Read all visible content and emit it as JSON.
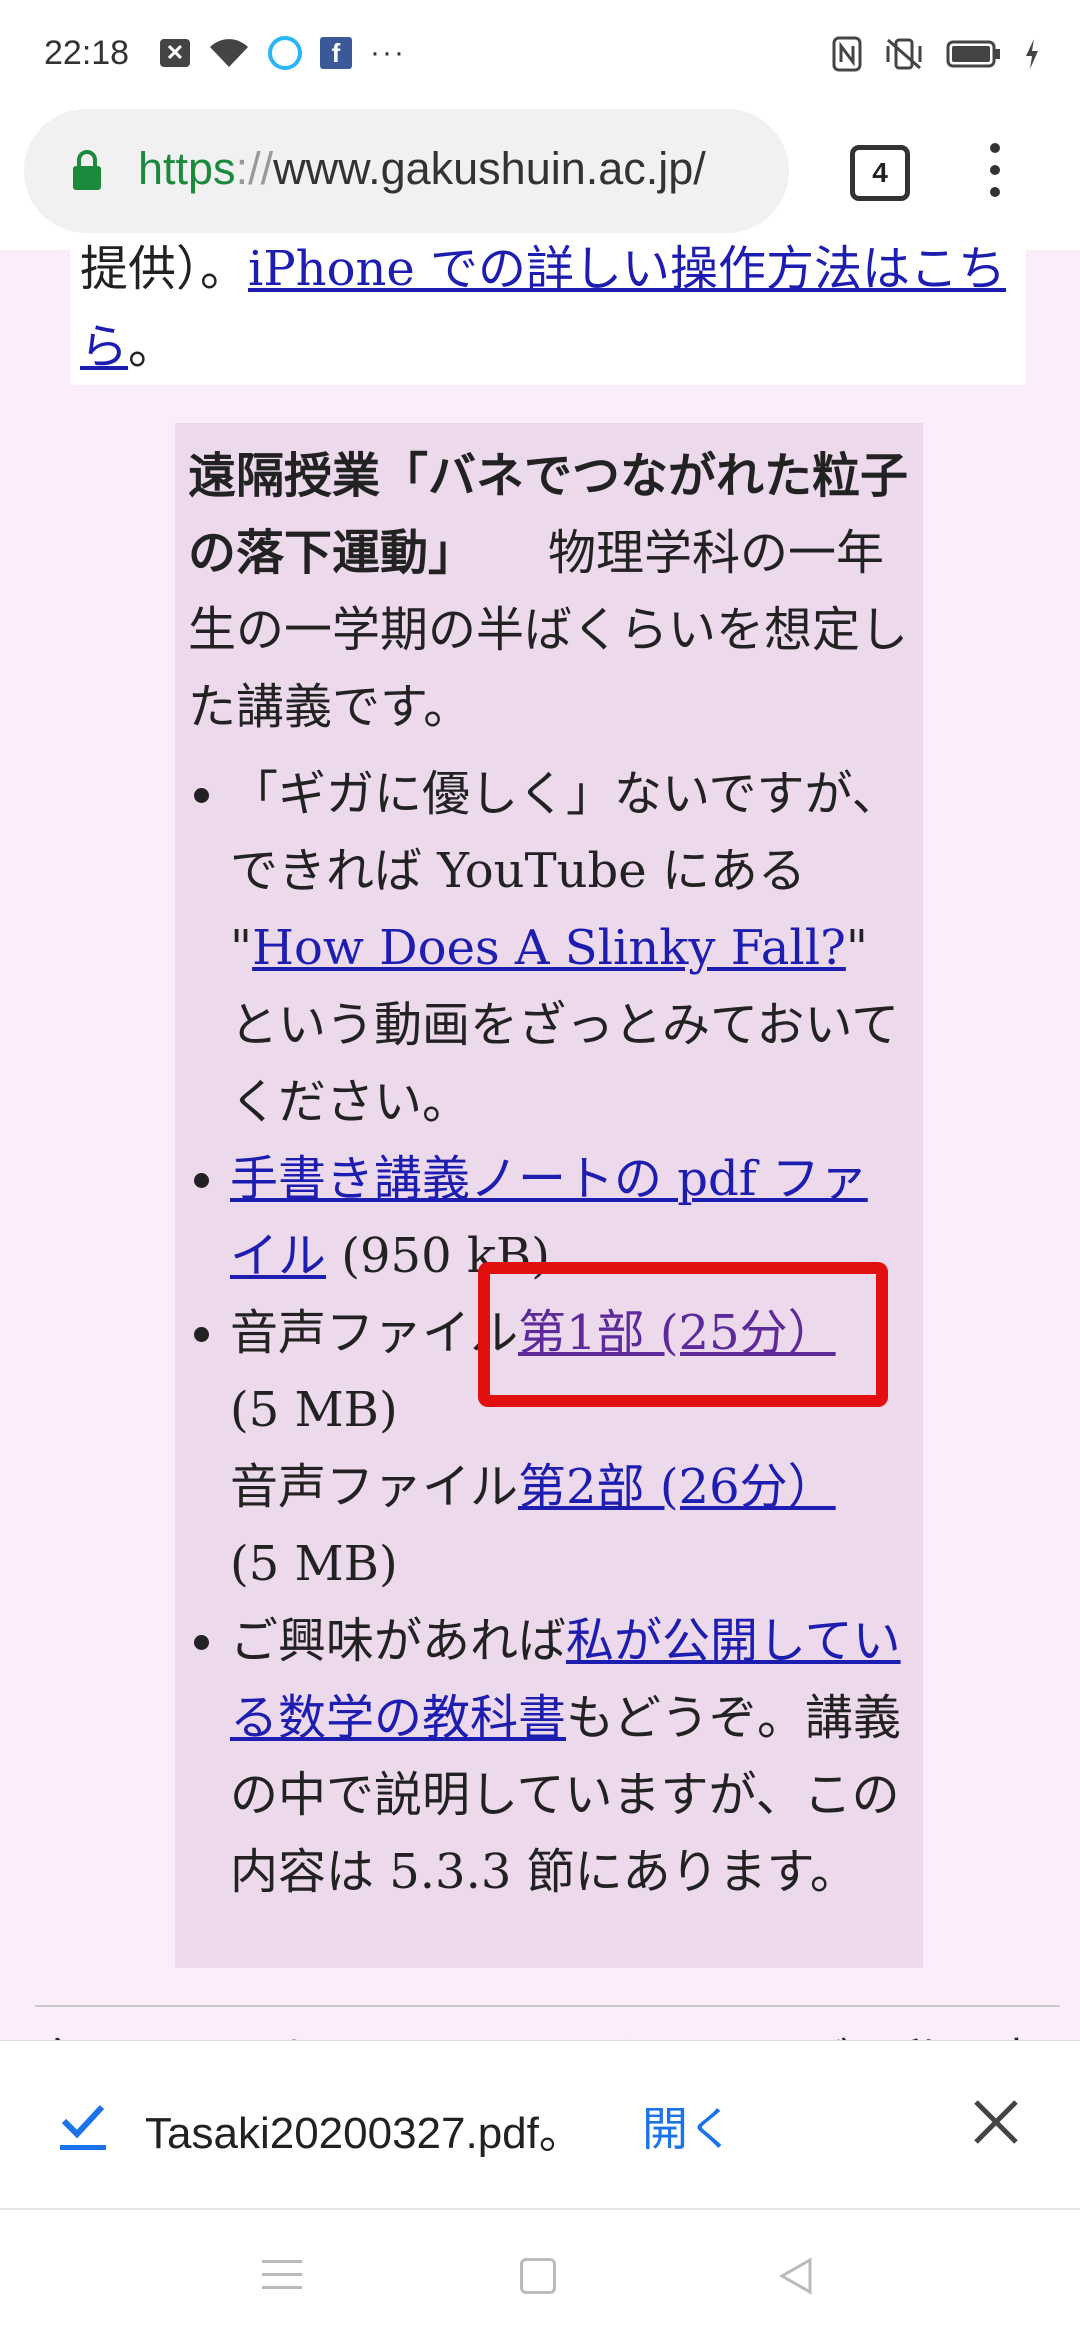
{
  "status": {
    "time": "22:18",
    "dots": "···"
  },
  "browser": {
    "url_scheme": "https",
    "url_sep": "://",
    "url_rest": "www.gakushuin.ac.jp/",
    "tab_count": "4"
  },
  "page": {
    "top_prefix": "提供）。",
    "top_link": "iPhone での詳しい操作方法はこちら",
    "top_suffix": "。",
    "heading": "遠隔授業「バネでつながれた粒子の落下運動」",
    "intro": "物理学科の一年生の一学期の半ばくらいを想定した講義です。",
    "bullet1_a": "「ギガに優しく」ないですが、できれば YouTube にある \"",
    "bullet1_link": "How Does A Slinky Fall?",
    "bullet1_b": "\" という動画をざっとみておいてください。",
    "bullet2_link": "手書き講義ノートの pdf ファイル",
    "bullet2_size": " (950 kB)",
    "bullet3_label1": "音声ファイル",
    "bullet3_link1": "第1部 (25分）",
    "bullet3_size1": "(5 MB)",
    "bullet3_label2": "音声ファイル",
    "bullet3_link2": "第2部 (26分）",
    "bullet3_size2": "(5 MB)",
    "bullet4_a": "ご興味があれば",
    "bullet4_link": "私が公開している数学の教科書",
    "bullet4_b": "もどうぞ。講義の中で説明していますが、この内容は 5.3.3 節にあります。",
    "cut_text": "言うまでもないことかもしれませんが、私の書いたペ"
  },
  "download": {
    "filename": "Tasaki20200327.pdf。",
    "open_label": "開く"
  },
  "colors": {
    "highlight": "#e20f0f",
    "link": "#1d1db0",
    "visited": "#5c2a9a"
  }
}
